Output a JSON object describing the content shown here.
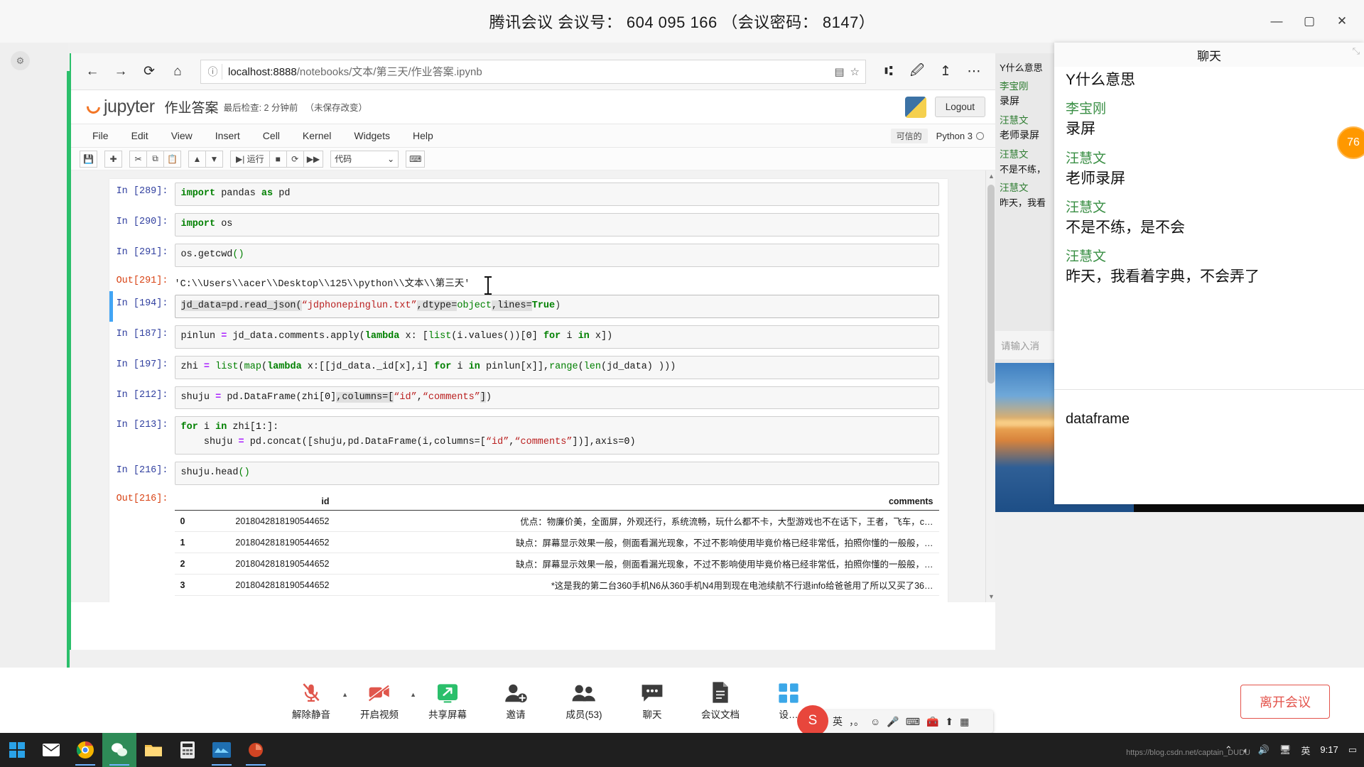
{
  "meeting": {
    "title": "腾讯会议 会议号： 604 095 166 （会议密码： 8147）",
    "minimize": "—",
    "maximize": "▢",
    "close": "✕"
  },
  "browser": {
    "back_icon": "←",
    "forward_icon": "→",
    "reload_icon": "⟳",
    "home_icon": "⌂",
    "info_icon": "ⓘ",
    "url_host": "localhost:8888",
    "url_path": "/notebooks/文本/第三天/作业答案.ipynb",
    "reader_icon": "▤",
    "star_icon": "☆",
    "collections_icon": "⑆",
    "notes_icon": "🖉",
    "share_icon": "↥",
    "more_icon": "⋯"
  },
  "jupyter": {
    "logo_text": "jupyter",
    "notebook_name": "作业答案",
    "save_info": "最后检查: 2 分钟前",
    "unsaved": "（未保存改变）",
    "logout": "Logout",
    "menus": [
      "File",
      "Edit",
      "View",
      "Insert",
      "Cell",
      "Kernel",
      "Widgets",
      "Help"
    ],
    "trusted": "可信的",
    "kernel": "Python 3",
    "toolbar": {
      "save": "💾",
      "add": "✚",
      "cut": "✂",
      "copy": "⧉",
      "paste": "📋",
      "up": "▲",
      "down": "▼",
      "run": "▶| 运行",
      "stop": "■",
      "restart": "⟳",
      "restart_run_all": "▶▶",
      "celltype": "代码",
      "celltype_caret": "⌄",
      "command_palette": "⌨"
    },
    "cells": [
      {
        "type": "code",
        "prompt": "In  [289]:",
        "selected": false,
        "code_html": "<span class=\"kw\">import</span> pandas <span class=\"kw\">as</span> pd"
      },
      {
        "type": "code",
        "prompt": "In  [290]:",
        "selected": false,
        "code_html": "<span class=\"kw\">import</span> os"
      },
      {
        "type": "code",
        "prompt": "In  [291]:",
        "selected": false,
        "code_html": "os.getcwd<span class=\"bi\">()</span>"
      },
      {
        "type": "output",
        "prompt": "Out[291]:",
        "text": "'C:\\\\Users\\\\acer\\\\Desktop\\\\125\\\\python\\\\文本\\\\第三天'"
      },
      {
        "type": "code",
        "prompt": "In  [194]:",
        "selected": true,
        "code_html": "<span class=\"hl\">jd_data=pd.read_json(</span><span class=\"str\">“jdphonepinglun.txt”</span><span class=\"hl\">,dtype=</span><span class=\"bi\">object</span><span class=\"hl\">,lines=</span><span class=\"kw\">True</span><span class=\"par\">)</span>"
      },
      {
        "type": "code",
        "prompt": "In  [187]:",
        "selected": false,
        "code_html": "pinlun <span class=\"op\">=</span> jd_data.comments.apply(<span class=\"kw\">lambda</span> x: [<span class=\"bi\">list</span>(i.values())[<span class=\"num\">0</span>] <span class=\"kw\">for</span> i <span class=\"kw\">in</span> x])"
      },
      {
        "type": "code",
        "prompt": "In  [197]:",
        "selected": false,
        "code_html": "zhi <span class=\"op\">=</span> <span class=\"bi\">list</span>(<span class=\"bi\">map</span>(<span class=\"kw\">lambda</span> x:[[jd_data._id[x],i] <span class=\"kw\">for</span> i <span class=\"kw\">in</span> pinlun[x]],<span class=\"bi\">range</span>(<span class=\"bi\">len</span>(jd_data) )))"
      },
      {
        "type": "code",
        "prompt": "In  [212]:",
        "selected": false,
        "code_html": "shuju <span class=\"op\">=</span> pd.DataFrame(zhi[<span class=\"num\">0</span>]<span class=\"hl\">,columns=[</span><span class=\"str\">“id”</span>,<span class=\"str\">“comments”</span><span class=\"hl\">]</span>)"
      },
      {
        "type": "code",
        "prompt": "In  [213]:",
        "selected": false,
        "code_html": "<span class=\"kw\">for</span> i <span class=\"kw\">in</span> zhi[<span class=\"num\">1</span>:]:\n    shuju <span class=\"op\">=</span> pd.concat([shuju,pd.DataFrame(i,columns=[<span class=\"str\">“id”</span>,<span class=\"str\">“comments”</span>])],axis=<span class=\"num\">0</span>)"
      },
      {
        "type": "code",
        "prompt": "In  [216]:",
        "selected": false,
        "code_html": "shuju.head<span class=\"bi\">()</span>"
      }
    ],
    "dataframe": {
      "prompt": "Out[216]:",
      "columns": [
        "id",
        "comments"
      ],
      "rows": [
        {
          "index": "0",
          "id": "2018042818190544652",
          "comments": "优点：物廉价美，全面屏，外观还行，系统流畅，玩什么都不卡，大型游戏也不在话下，王者，飞车，c…"
        },
        {
          "index": "1",
          "id": "2018042818190544652",
          "comments": "缺点：屏幕显示效果一般，侧面看漏光现象，不过不影响使用毕竟价格已经非常低，拍照你懂的一般般，…"
        },
        {
          "index": "2",
          "id": "2018042818190544652",
          "comments": "缺点：屏幕显示效果一般，侧面看漏光现象，不过不影响使用毕竟价格已经非常低，拍照你懂的一般般，…"
        },
        {
          "index": "3",
          "id": "2018042818190544652",
          "comments": "*这是我的第二台360手机N6从360手机N4用到现在电池续航不行退info给爸爸用了所以又买了36…"
        }
      ]
    }
  },
  "chat": {
    "header": "聊天",
    "messages": [
      {
        "name": "",
        "text": "Y什么意思"
      },
      {
        "name": "李宝刚",
        "text": "录屏"
      },
      {
        "name": "汪慧文",
        "text": "老师录屏"
      },
      {
        "name": "汪慧文",
        "text": "不是不练，是不会"
      },
      {
        "name": "汪慧文",
        "text": "昨天，我看着字典，不会弄了"
      }
    ],
    "compose_value": "dataframe",
    "unread_badge": "76"
  },
  "video_strip": {
    "peek_lines": [
      {
        "kind": "msg",
        "text": "Y什么意思"
      },
      {
        "kind": "name",
        "text": "李宝刚"
      },
      {
        "kind": "msg",
        "text": "录屏"
      },
      {
        "kind": "name",
        "text": "汪慧文"
      },
      {
        "kind": "msg",
        "text": "老师录屏"
      },
      {
        "kind": "name",
        "text": "汪慧文"
      },
      {
        "kind": "msg",
        "text": "不是不练，"
      },
      {
        "kind": "name",
        "text": "汪慧文"
      },
      {
        "kind": "msg",
        "text": "昨天，我看"
      }
    ],
    "input_placeholder": "请输入消"
  },
  "controls": [
    {
      "id": "mute",
      "label": "解除静音",
      "icon": "mic-off",
      "caret": true
    },
    {
      "id": "video",
      "label": "开启视频",
      "icon": "camera-off",
      "caret": true
    },
    {
      "id": "share",
      "label": "共享屏幕",
      "icon": "share",
      "caret": false
    },
    {
      "id": "invite",
      "label": "邀请",
      "icon": "invite",
      "caret": false
    },
    {
      "id": "members",
      "label": "成员(53)",
      "icon": "members",
      "caret": false
    },
    {
      "id": "chat",
      "label": "聊天",
      "icon": "chat",
      "caret": false
    },
    {
      "id": "docs",
      "label": "会议文档",
      "icon": "document",
      "caret": false
    },
    {
      "id": "settings",
      "label": "设…",
      "icon": "apps",
      "caret": false
    }
  ],
  "leave_button": "离开会议",
  "ime": {
    "logo": "S",
    "mode": "英",
    "punct": "，。",
    "emoji": "☺",
    "mic": "🎤",
    "keyboard": "⌨",
    "toolbox": "🧰",
    "up": "⬆",
    "panel": "▦"
  },
  "taskbar": {
    "start": "⊞",
    "apps": [
      "mail",
      "chrome",
      "wechat",
      "explorer",
      "calc",
      "editor",
      "ppt"
    ],
    "tray": {
      "chevron": "⌃",
      "wifi": "◖",
      "volume": "🔊",
      "screen": "🖥",
      "extra": "▭",
      "ime": "英"
    },
    "clock_time": "9:17",
    "clock_date": "",
    "notify": "▭"
  },
  "watermark": "https://blog.csdn.net/captain_DUDU"
}
